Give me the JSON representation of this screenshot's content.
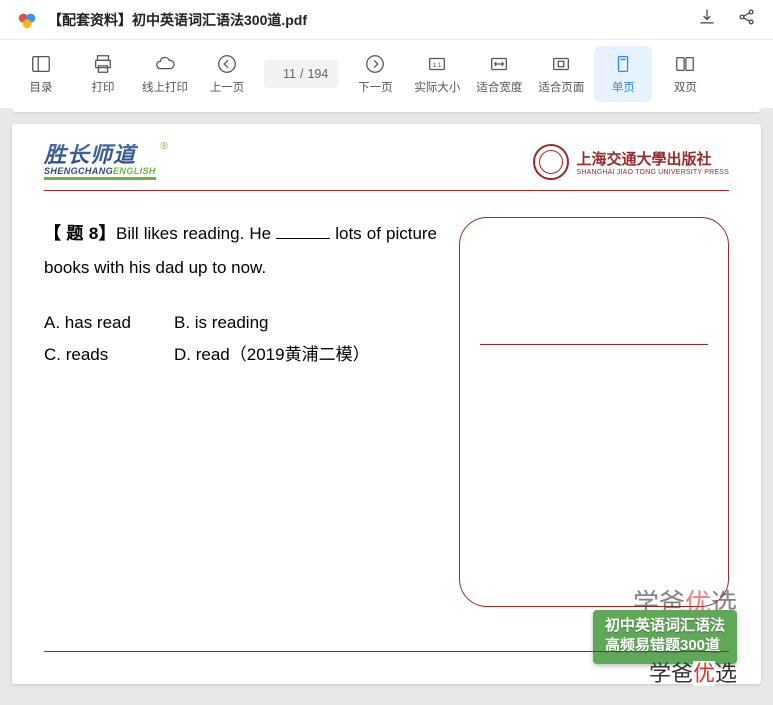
{
  "header": {
    "filename": "【配套资料】初中英语词汇语法300道.pdf"
  },
  "toolbar": {
    "toc": "目录",
    "print": "打印",
    "cloud_print": "线上打印",
    "prev": "上一页",
    "next": "下一页",
    "actual": "实际大小",
    "fit_width": "适合宽度",
    "fit_page": "适合页面",
    "single": "单页",
    "double": "双页",
    "page_current": "11",
    "page_total": "194"
  },
  "doc": {
    "brand_left_main": "胜长师道",
    "brand_left_sub_a": "SHENGCHANG",
    "brand_left_sub_b": "ENGLISH",
    "uni_cn_a": "上海交通大學",
    "uni_cn_b": "出版社",
    "uni_en": "SHANGHAI JIAO TONG UNIVERSITY PRESS",
    "question_label": "【 题 8】",
    "question_text_a": "Bill  likes  reading.  He ",
    "question_text_b": " lots of picture books with his dad up to now.",
    "options": {
      "A": "A. has read",
      "B": "B. is reading",
      "C": "C. reads",
      "D": "D. read（2019黄浦二模）"
    },
    "ghost_a": "学爸",
    "ghost_b": "优",
    "ghost_c": "选",
    "badge_line1": "初中英语词汇语法",
    "badge_line2": "高频易错题300道",
    "footer_a": "学爸",
    "footer_b": "优",
    "footer_c": "选"
  }
}
